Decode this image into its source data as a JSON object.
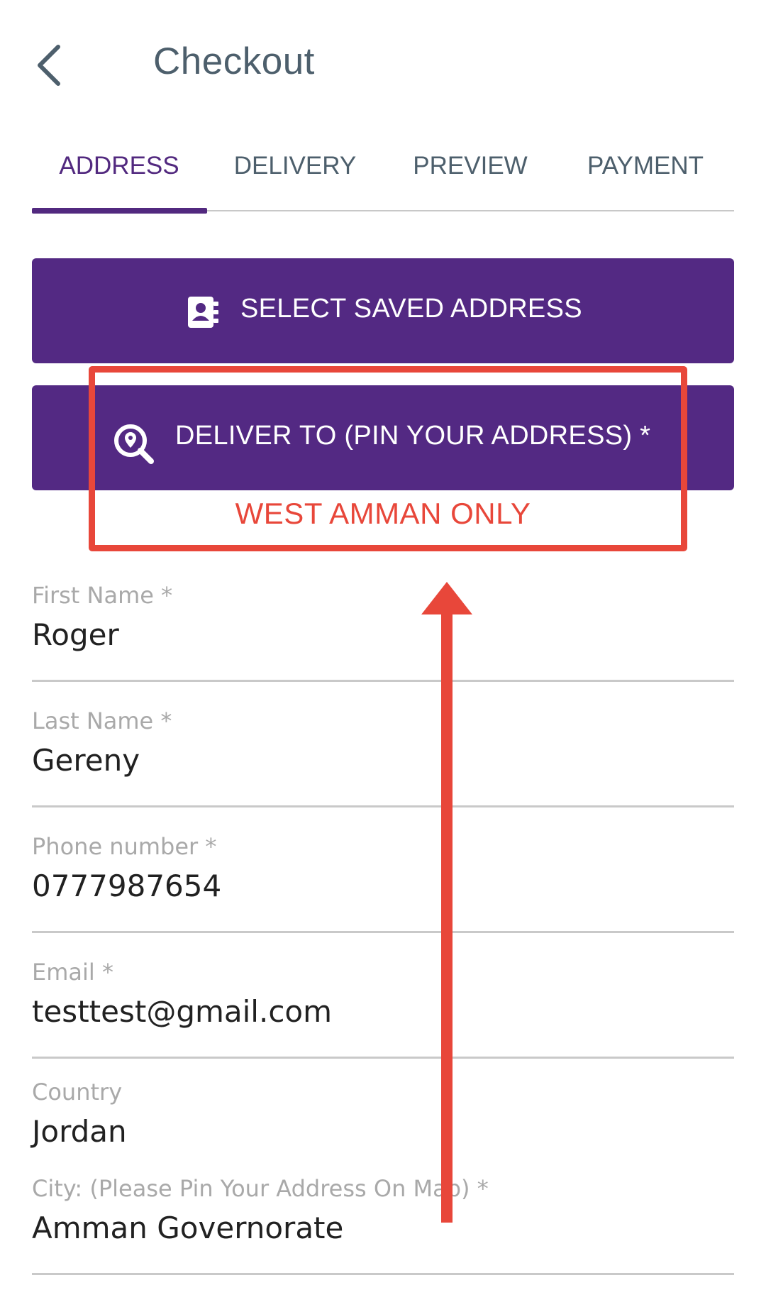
{
  "header": {
    "title": "Checkout",
    "back_icon": "chevron-left-icon"
  },
  "tabs": [
    {
      "label": "ADDRESS",
      "active": true
    },
    {
      "label": "DELIVERY",
      "active": false
    },
    {
      "label": "PREVIEW",
      "active": false
    },
    {
      "label": "PAYMENT",
      "active": false
    }
  ],
  "buttons": {
    "saved_address": {
      "label": "SELECT SAVED ADDRESS",
      "icon": "address-book-icon"
    },
    "deliver_to": {
      "label": "DELIVER TO (PIN YOUR ADDRESS) *",
      "icon": "location-search-icon"
    }
  },
  "annotation": {
    "note": "WEST AMMAN ONLY",
    "color": "#e8473a"
  },
  "form": {
    "first_name": {
      "label": "First Name *",
      "value": "Roger"
    },
    "last_name": {
      "label": "Last Name *",
      "value": "Gereny"
    },
    "phone": {
      "label": "Phone number *",
      "value": "0777987654"
    },
    "email": {
      "label": "Email *",
      "value": "testtest@gmail.com"
    },
    "country": {
      "label": "Country",
      "value": "Jordan"
    },
    "city": {
      "label": "City: (Please Pin Your Address On Map) *",
      "value": "Amman Governorate"
    }
  },
  "colors": {
    "accent": "#532983",
    "text_muted": "#4d5f6c"
  }
}
